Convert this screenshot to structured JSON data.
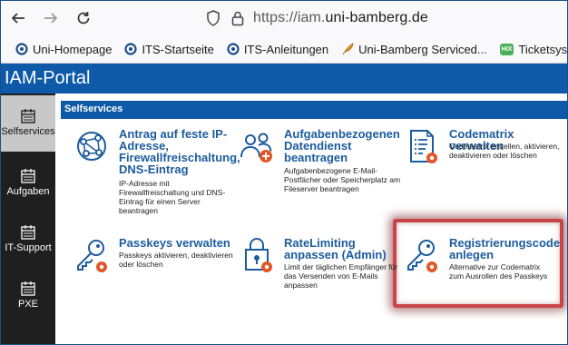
{
  "browser": {
    "url_prefix": "https://iam.",
    "url_host": "uni-bamberg.de"
  },
  "bookmarks": [
    {
      "label": "Uni-Homepage"
    },
    {
      "label": "ITS-Startseite"
    },
    {
      "label": "ITS-Anleitungen"
    },
    {
      "label": "Uni-Bamberg Serviced..."
    },
    {
      "label": "Ticketsystem",
      "badge": "HIX"
    }
  ],
  "app": {
    "title": "IAM-Portal"
  },
  "sidebar": {
    "items": [
      {
        "label": "Selfservices"
      },
      {
        "label": "Aufgaben"
      },
      {
        "label": "IT-Support"
      },
      {
        "label": "PXE"
      }
    ]
  },
  "section": {
    "title": "Selfservices"
  },
  "tiles": [
    {
      "title": "Antrag auf feste IP-Adresse, Firewallfreischaltung, DNS-Eintrag",
      "desc": "IP-Adresse mit Firewallfreischaltung und DNS-Eintrag für einen Server beantragen"
    },
    {
      "title": "Aufgabenbezogenen Datendienst beantragen",
      "desc": "Aufgabenbezogene E-Mail-Postfächer oder Speicherplatz am Fileserver beantragen"
    },
    {
      "title": "Codematrix verwalten",
      "desc": "Codematrix erstellen, aktivieren, deaktivieren oder löschen"
    },
    {
      "title": "Passkeys verwalten",
      "desc": "Passkeys aktivieren, deaktivieren oder löschen"
    },
    {
      "title": "RateLimiting anpassen (Admin)",
      "desc": "Limit der täglichen Empfänger für das Versenden von E-Mails anpassen"
    },
    {
      "title": "Registrierungscode anlegen",
      "desc": "Alternative zur Codematrix zum Ausrollen des Passkeys"
    }
  ],
  "colors": {
    "header_blue": "#0e5aa8",
    "tile_title": "#1c5c9e",
    "sidebar_bg": "#1f1f1f",
    "highlight": "#c8454a",
    "gear_orange": "#e2562a"
  }
}
